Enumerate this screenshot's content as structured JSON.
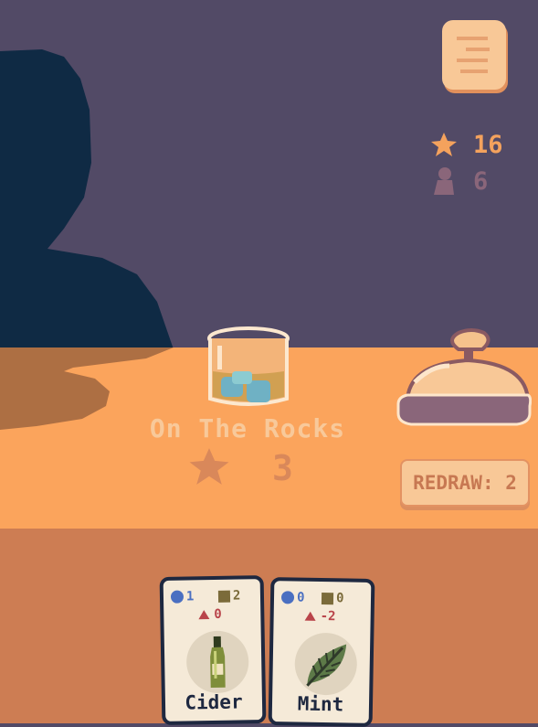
{
  "hud": {
    "stars": "16",
    "customers": "6",
    "icons": {
      "notes": "notes-icon",
      "stars": "star-icon",
      "customers": "person-icon"
    }
  },
  "drink": {
    "name": "On The Rocks",
    "score": "3",
    "icon": "star-icon"
  },
  "redraw": {
    "label": "REDRAW: 2"
  },
  "bell": {
    "icon": "service-bell-icon"
  },
  "cards": [
    {
      "name": "Cider",
      "blue": "1",
      "olive": "2",
      "red": "0",
      "art": "bottle-icon"
    },
    {
      "name": "Mint",
      "blue": "0",
      "olive": "0",
      "red": "-2",
      "art": "leaf-icon"
    }
  ],
  "colors": {
    "wall": "#524a66",
    "silhouette": "#0f2a44",
    "counter_top": "#fba45c",
    "counter_front": "#cd7d53",
    "card_border": "#1e2840",
    "blue_stat": "#4a6fc1",
    "olive_stat": "#7b6b3a",
    "red_stat": "#b9444a"
  }
}
